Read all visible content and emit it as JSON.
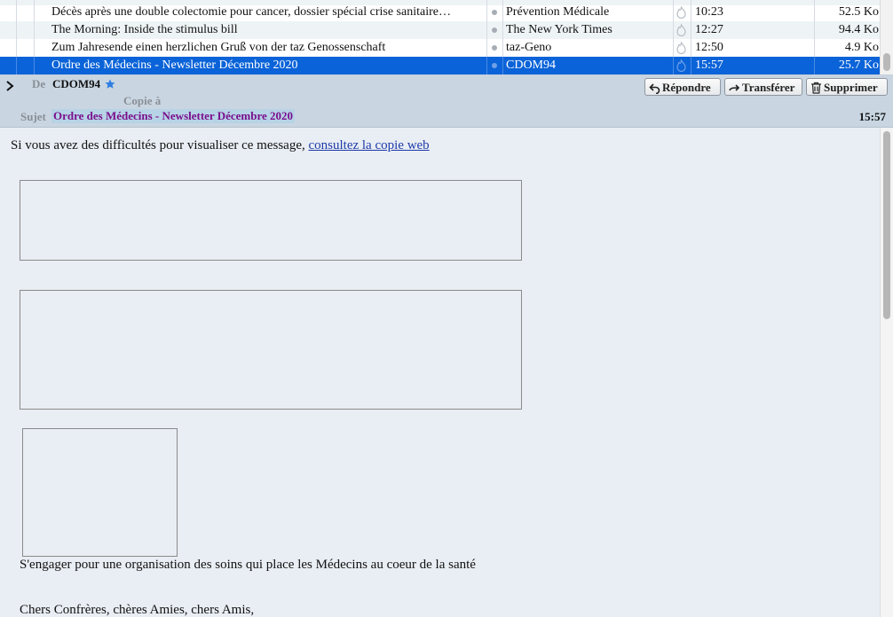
{
  "message_list": {
    "rows": [
      {
        "subject": "Décès après une double colectomie pour cancer, dossier spécial crise sanitaire…",
        "from": "Prévention Médicale",
        "time": "10:23",
        "size": "52.5 Ko"
      },
      {
        "subject": "The Morning: Inside the stimulus bill",
        "from": "The New York Times",
        "time": "12:27",
        "size": "94.4 Ko"
      },
      {
        "subject": "Zum Jahresende einen herzlichen Gruß von der taz Genossenschaft",
        "from": "taz-Geno",
        "time": "12:50",
        "size": "4.9 Ko"
      },
      {
        "subject": "Ordre des Médecins - Newsletter Décembre 2020",
        "from": "CDOM94",
        "time": "15:57",
        "size": "25.7 Ko",
        "selected": true
      }
    ]
  },
  "header": {
    "from_label": "De",
    "from_value": "CDOM94",
    "cc_label": "Copie à",
    "subject_label": "Sujet",
    "subject_value": "Ordre des Médecins - Newsletter Décembre 2020",
    "time": "15:57",
    "buttons": {
      "reply": "Répondre",
      "forward": "Transférer",
      "delete": "Supprimer"
    }
  },
  "body": {
    "intro_text": "Si vous avez des difficultés pour visualiser ce message, ",
    "intro_link": "consultez la copie web",
    "tagline": "S'engager pour une organisation des soins qui place les Médecins au coeur de la santé",
    "greeting": "Chers Confrères, chères Amies, chers Amis,"
  },
  "colors": {
    "selection": "#0a63d8",
    "header_bg": "#c9d6e2",
    "subject_color": "#7a0f8c",
    "link": "#1f3aa8"
  }
}
